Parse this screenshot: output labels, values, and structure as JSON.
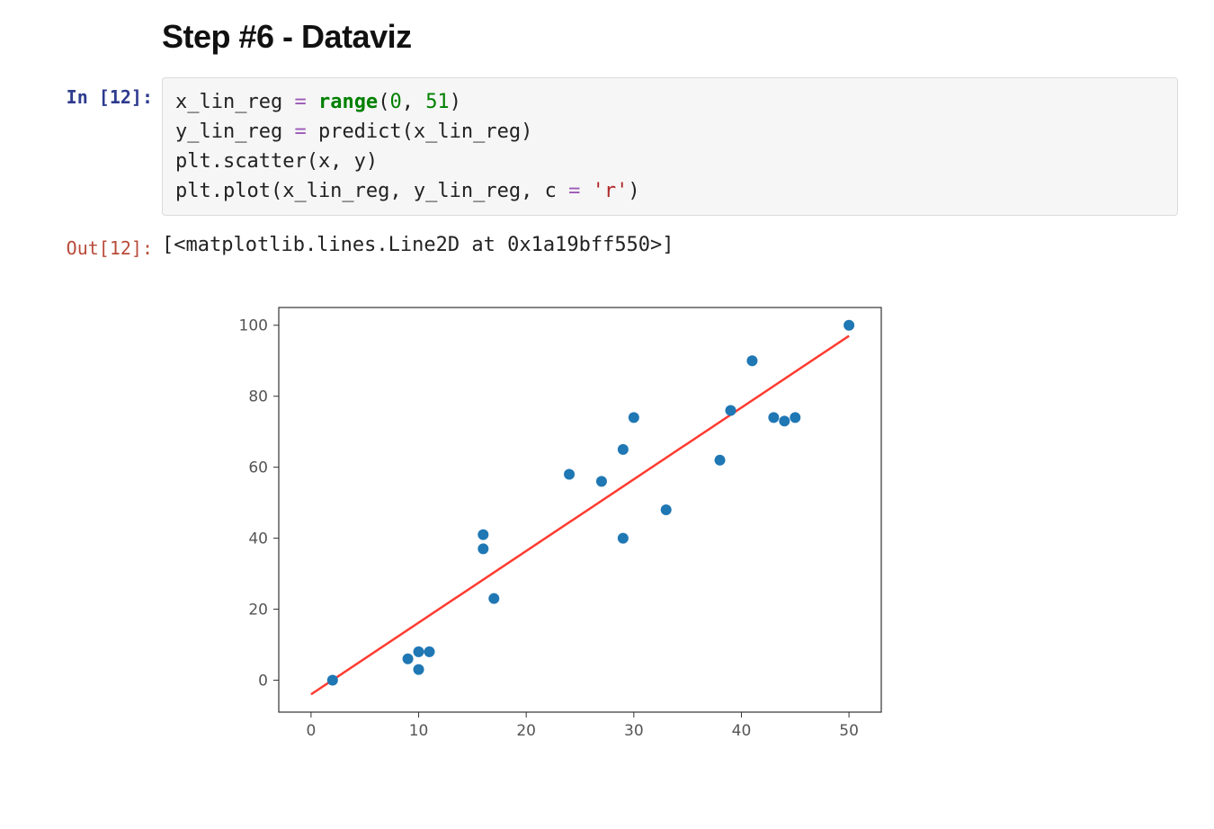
{
  "heading": "Step #6 - Dataviz",
  "in_prompt": "In [12]:",
  "out_prompt": "Out[12]:",
  "code": {
    "line1_a": "x_lin_reg ",
    "line1_op": "=",
    "line1_b": " ",
    "line1_kw": "range",
    "line1_c": "(",
    "line1_n0": "0",
    "line1_comma": ", ",
    "line1_n1": "51",
    "line1_d": ")",
    "line2_a": "y_lin_reg ",
    "line2_op": "=",
    "line2_b": " predict(x_lin_reg)",
    "line3": "plt.scatter(x, y)",
    "line4_a": "plt.plot(x_lin_reg, y_lin_reg, c ",
    "line4_op": "=",
    "line4_b": " ",
    "line4_str": "'r'",
    "line4_c": ")"
  },
  "output_text": "[<matplotlib.lines.Line2D at 0x1a19bff550>]",
  "chart_data": {
    "type": "scatter",
    "scatter": {
      "x": [
        2,
        9,
        10,
        10,
        11,
        16,
        16,
        17,
        24,
        27,
        29,
        29,
        30,
        33,
        38,
        39,
        41,
        43,
        44,
        45,
        50
      ],
      "y": [
        0,
        6,
        8,
        3,
        8,
        41,
        37,
        23,
        58,
        56,
        65,
        40,
        74,
        48,
        62,
        76,
        90,
        74,
        73,
        74,
        100
      ]
    },
    "regression_line": {
      "x": [
        0,
        50
      ],
      "y": [
        -4,
        97
      ]
    },
    "x_ticks": [
      0,
      10,
      20,
      30,
      40,
      50
    ],
    "y_ticks": [
      0,
      20,
      40,
      60,
      80,
      100
    ],
    "xlim": [
      -3,
      53
    ],
    "ylim": [
      -9,
      105
    ],
    "title": "",
    "xlabel": "",
    "ylabel": ""
  }
}
